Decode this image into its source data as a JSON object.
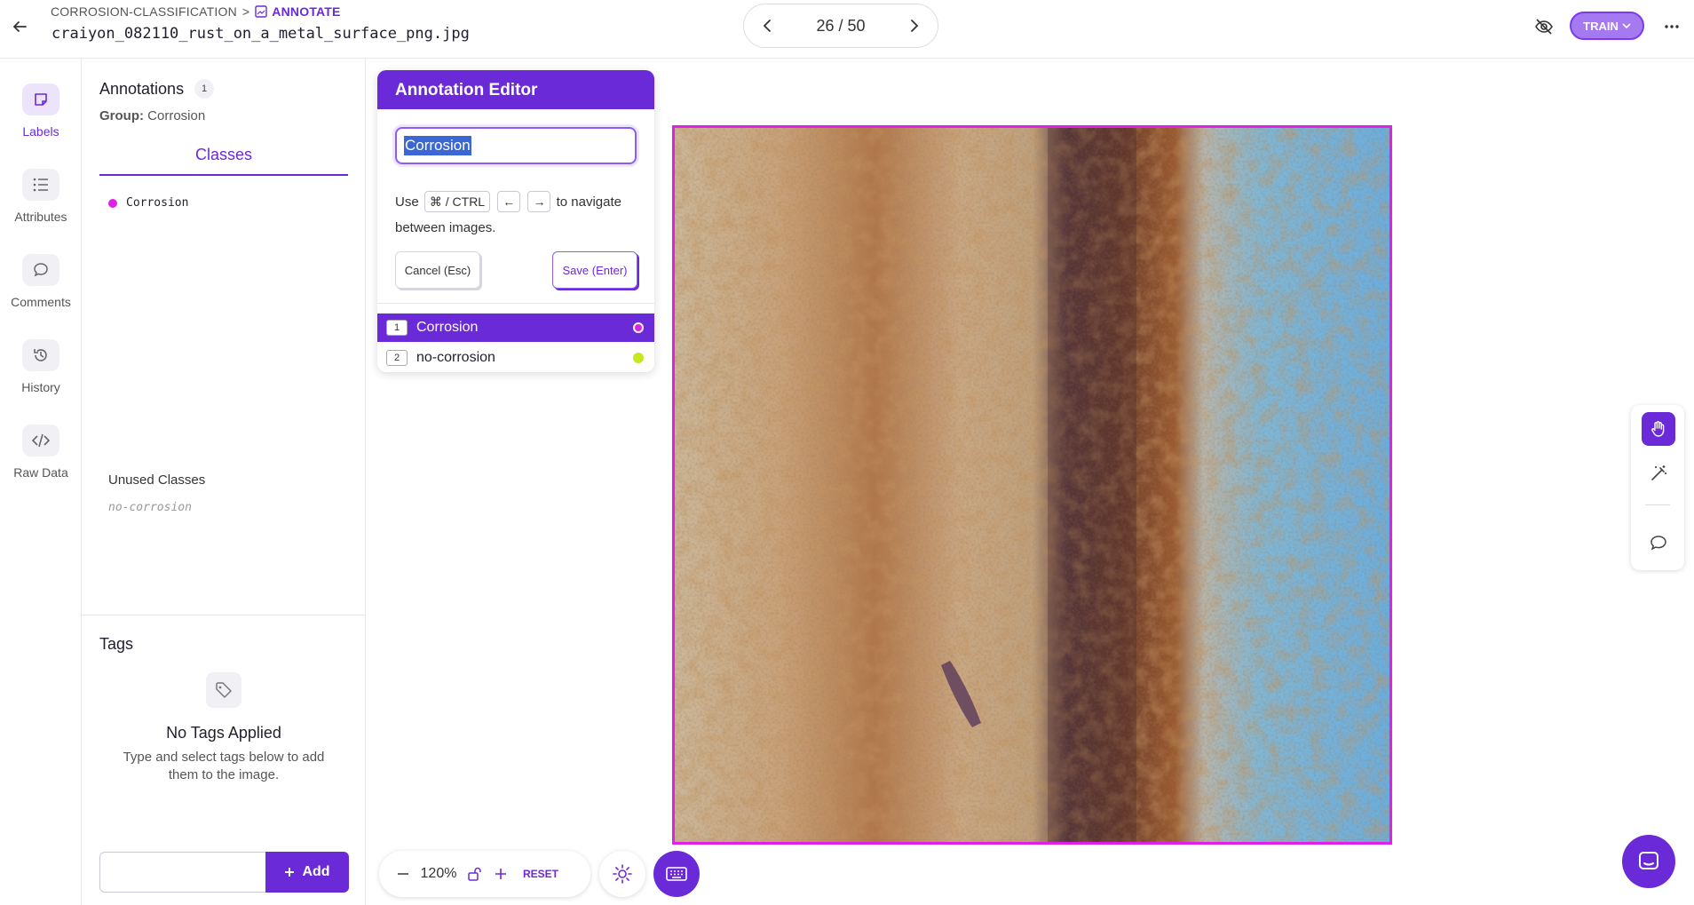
{
  "header": {
    "breadcrumb_project": "CORROSION-CLASSIFICATION",
    "breadcrumb_separator": ">",
    "breadcrumb_current": "ANNOTATE",
    "filename": "craiyon_082110_rust_on_a_metal_surface_png.jpg",
    "pager": "26 / 50",
    "train_label": "TRAIN"
  },
  "rail": {
    "labels": "Labels",
    "attributes": "Attributes",
    "comments": "Comments",
    "history": "History",
    "raw_data": "Raw Data"
  },
  "panel": {
    "title": "Annotations",
    "count": "1",
    "group_label": "Group:",
    "group_value": "Corrosion",
    "classes_tab": "Classes",
    "class_item": "Corrosion",
    "unused_title": "Unused Classes",
    "unused_item": "no-corrosion",
    "tags_title": "Tags",
    "tags_empty": "No Tags Applied",
    "tags_hint": "Type and select tags below to add them to the image.",
    "add_label": "Add"
  },
  "editor": {
    "title": "Annotation Editor",
    "input_value": "Corrosion",
    "help_use": "Use",
    "key_modifier": "⌘ / CTRL",
    "key_left": "←",
    "key_right": "→",
    "help_rest": "to navigate between images.",
    "cancel": "Cancel (Esc)",
    "save": "Save (Enter)",
    "options": [
      {
        "num": "1",
        "label": "Corrosion",
        "color": "#e020e8"
      },
      {
        "num": "2",
        "label": "no-corrosion",
        "color": "#c6e820"
      }
    ]
  },
  "zoom": {
    "value": "120%",
    "reset": "RESET"
  },
  "colors": {
    "accent": "#6b2ad8",
    "corrosion": "#e020e8",
    "no_corrosion": "#c6e820"
  }
}
